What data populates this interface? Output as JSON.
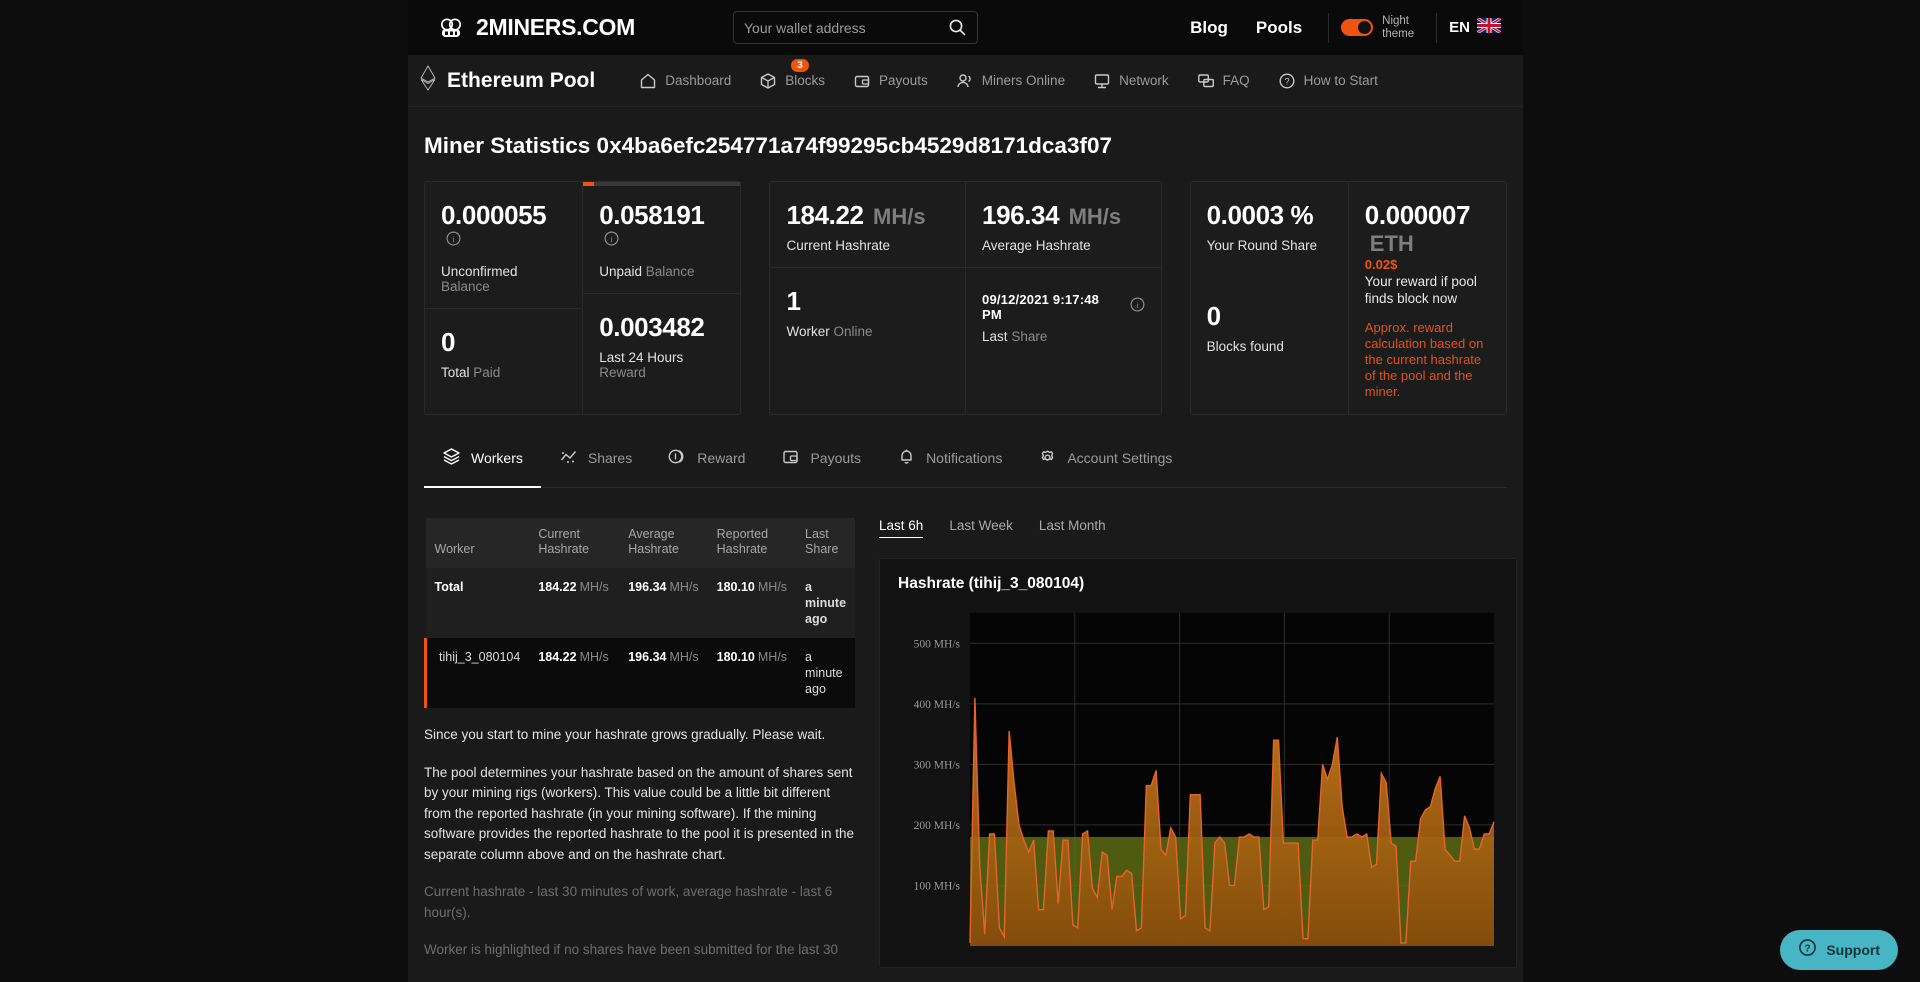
{
  "header": {
    "brand": "2MINERS.COM",
    "search_placeholder": "Your wallet address",
    "search_value": "",
    "blog": "Blog",
    "pools": "Pools",
    "night_theme": "Night theme",
    "lang": "EN"
  },
  "subnav": {
    "pool_name": "Ethereum Pool",
    "items": [
      {
        "label": "Dashboard",
        "icon": "home-icon"
      },
      {
        "label": "Blocks",
        "icon": "cube-icon",
        "badge": "3"
      },
      {
        "label": "Payouts",
        "icon": "wallet-icon"
      },
      {
        "label": "Miners Online",
        "icon": "users-icon"
      },
      {
        "label": "Network",
        "icon": "monitor-icon"
      },
      {
        "label": "FAQ",
        "icon": "chat-icon"
      },
      {
        "label": "How to Start",
        "icon": "question-icon"
      }
    ]
  },
  "page_title": "Miner Statistics 0x4ba6efc254771a74f99295cb4529d8171dca3f07",
  "stats": {
    "unconfirmed_balance": {
      "value": "0.000055",
      "label_strong": "Unconfirmed",
      "label_muted": "Balance"
    },
    "unpaid_balance": {
      "value": "0.058191",
      "label_strong": "Unpaid",
      "label_muted": "Balance",
      "progress_pct": 7
    },
    "total_paid": {
      "value": "0",
      "label_strong": "Total",
      "label_muted": "Paid"
    },
    "last_24h": {
      "value": "0.003482",
      "label_strong": "Last 24 Hours",
      "label_muted": "Reward"
    },
    "current_hashrate": {
      "value": "184.22",
      "unit": "MH/s",
      "label": "Current Hashrate"
    },
    "average_hashrate": {
      "value": "196.34",
      "unit": "MH/s",
      "label": "Average Hashrate"
    },
    "workers_online": {
      "value": "1",
      "label_strong": "Worker",
      "label_muted": "Online"
    },
    "last_share": {
      "value": "09/12/2021 9:17:48 PM",
      "label_strong": "Last",
      "label_muted": "Share"
    },
    "round_share": {
      "value": "0.0003 %",
      "label": "Your Round Share"
    },
    "blocks_found": {
      "value": "0",
      "label": "Blocks found"
    },
    "reward": {
      "value": "0.000007",
      "unit": "ETH",
      "usd": "0.02$",
      "caption": "Your reward if pool finds block now",
      "note": "Approx. reward calculation based on the current hashrate of the pool and the miner."
    }
  },
  "tabs": [
    {
      "label": "Workers",
      "icon": "layers-icon",
      "active": true
    },
    {
      "label": "Shares",
      "icon": "shares-icon",
      "active": false
    },
    {
      "label": "Reward",
      "icon": "coins-icon",
      "active": false
    },
    {
      "label": "Payouts",
      "icon": "wallet-icon",
      "active": false
    },
    {
      "label": "Notifications",
      "icon": "bell-icon",
      "active": false
    },
    {
      "label": "Account Settings",
      "icon": "gear-icon",
      "active": false
    }
  ],
  "workers_table": {
    "columns": [
      "Worker",
      "Current Hashrate",
      "Average Hashrate",
      "Reported Hashrate",
      "Last Share"
    ],
    "rows": [
      {
        "worker": "Total",
        "current": "184.22",
        "current_unit": "MH/s",
        "average": "196.34",
        "average_unit": "MH/s",
        "reported": "180.10",
        "reported_unit": "MH/s",
        "last_share": "a minute ago",
        "highlighted": false
      },
      {
        "worker": "tihij_3_080104",
        "current": "184.22",
        "current_unit": "MH/s",
        "average": "196.34",
        "average_unit": "MH/s",
        "reported": "180.10",
        "reported_unit": "MH/s",
        "last_share": "a minute ago",
        "highlighted": true
      }
    ]
  },
  "notes": {
    "p1": "Since you start to mine your hashrate grows gradually. Please wait.",
    "p2": "The pool determines your hashrate based on the amount of shares sent by your mining rigs (workers). This value could be a little bit different from the reported hashrate (in your mining software). If the mining software provides the reported hashrate to the pool it is presented in the separate column above and on the hashrate chart.",
    "p3": "Current hashrate - last 30 minutes of work, average hashrate - last 6 hour(s).",
    "p4": "Worker is highlighted if no shares have been submitted for the last 30"
  },
  "range_tabs": [
    {
      "label": "Last 6h",
      "active": true
    },
    {
      "label": "Last Week",
      "active": false
    },
    {
      "label": "Last Month",
      "active": false
    }
  ],
  "support": {
    "label": "Support"
  },
  "colors": {
    "accent": "#f0530f",
    "chart_line": "#e8622a",
    "chart_fill_top": "#d1821c",
    "chart_fill_bottom": "#8a4a0a",
    "reported_band": "#5c6b14",
    "support_bg": "#48b5c4"
  },
  "chart_data": {
    "type": "area",
    "title": "Hashrate (tihij_3_080104)",
    "xlabel": "",
    "ylabel": "MH/s",
    "ylim": [
      0,
      550
    ],
    "grid": true,
    "ytick_labels": [
      "500 MH/s",
      "400 MH/s",
      "300 MH/s",
      "200 MH/s",
      "100 MH/s"
    ],
    "yticks": [
      500,
      400,
      300,
      200,
      100
    ],
    "reported_hashrate_level": 180.1,
    "legend": [],
    "series": [
      {
        "name": "Current Hashrate",
        "color": "#e8622a",
        "values": [
          5,
          410,
          130,
          20,
          185,
          185,
          30,
          15,
          355,
          270,
          200,
          175,
          155,
          175,
          60,
          60,
          190,
          190,
          70,
          175,
          175,
          35,
          30,
          185,
          190,
          95,
          80,
          155,
          150,
          60,
          115,
          115,
          125,
          120,
          25,
          30,
          265,
          265,
          290,
          160,
          150,
          195,
          180,
          45,
          50,
          250,
          250,
          250,
          30,
          25,
          170,
          180,
          170,
          100,
          100,
          180,
          180,
          185,
          180,
          180,
          60,
          65,
          340,
          340,
          170,
          170,
          170,
          170,
          12,
          12,
          175,
          175,
          300,
          275,
          300,
          345,
          230,
          180,
          180,
          185,
          180,
          185,
          130,
          135,
          285,
          270,
          170,
          165,
          5,
          5,
          140,
          140,
          210,
          225,
          230,
          260,
          280,
          160,
          150,
          140,
          140,
          215,
          195,
          160,
          160,
          185,
          185,
          205
        ]
      }
    ]
  }
}
